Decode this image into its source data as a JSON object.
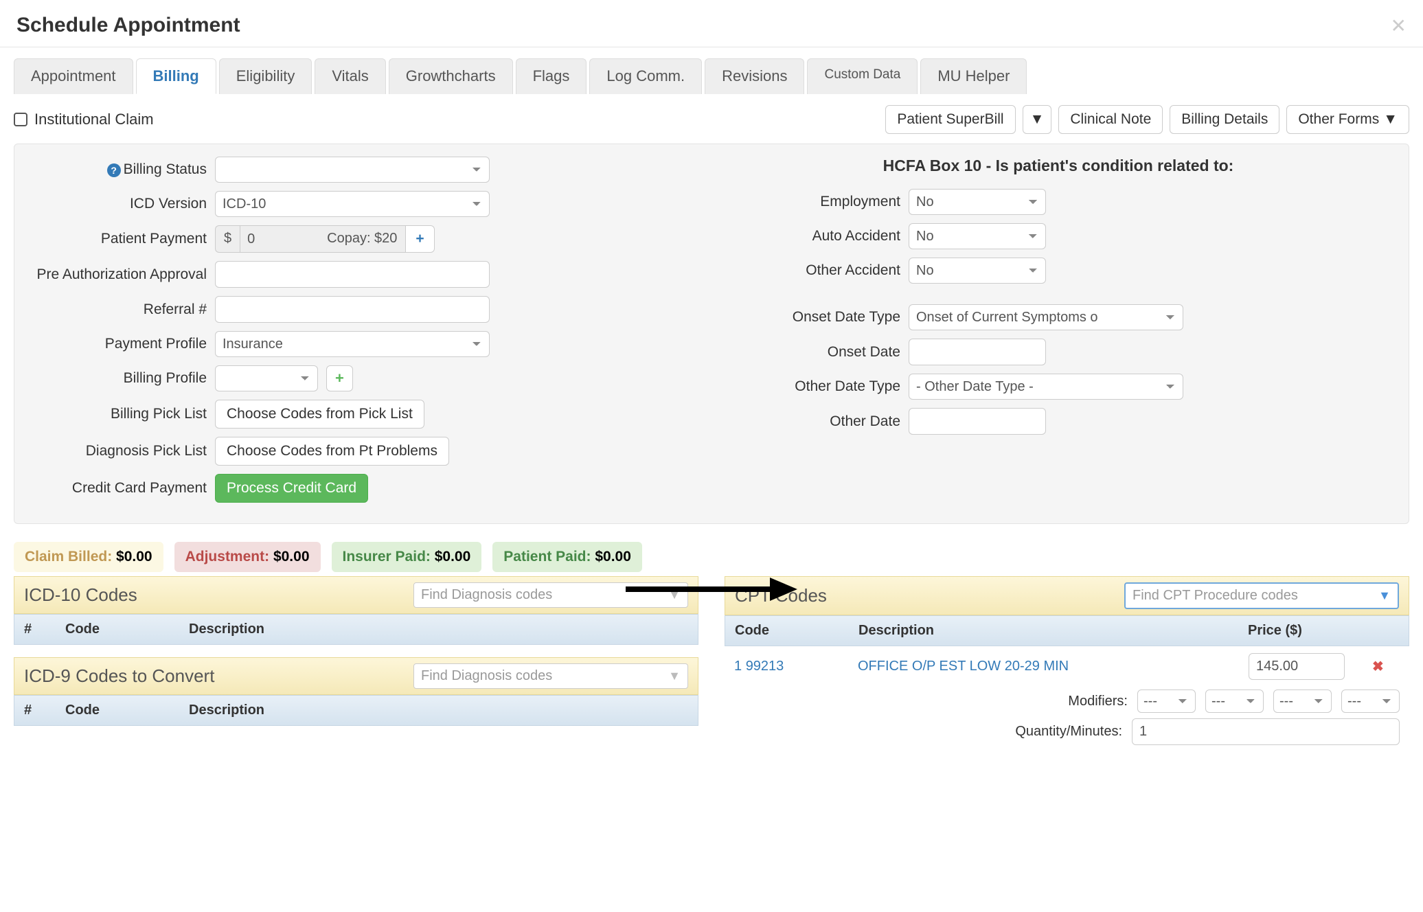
{
  "header": {
    "title": "Schedule Appointment"
  },
  "tabs": [
    "Appointment",
    "Billing",
    "Eligibility",
    "Vitals",
    "Growthcharts",
    "Flags",
    "Log Comm.",
    "Revisions",
    "Custom Data",
    "MU Helper"
  ],
  "active_tab": "Billing",
  "institutional_claim_label": "Institutional Claim",
  "top_buttons": {
    "superbill": "Patient SuperBill",
    "clinical_note": "Clinical Note",
    "billing_details": "Billing Details",
    "other_forms": "Other Forms"
  },
  "left_form": {
    "billing_status_label": "Billing Status",
    "icd_version_label": "ICD Version",
    "icd_version_value": "ICD-10",
    "patient_payment_label": "Patient Payment",
    "patient_payment_currency": "$",
    "patient_payment_value": "0",
    "patient_payment_copay": "Copay: $20",
    "pre_auth_label": "Pre Authorization Approval",
    "referral_label": "Referral #",
    "payment_profile_label": "Payment Profile",
    "payment_profile_value": "Insurance",
    "billing_profile_label": "Billing Profile",
    "billing_picklist_label": "Billing Pick List",
    "billing_picklist_btn": "Choose Codes from Pick List",
    "diagnosis_picklist_label": "Diagnosis Pick List",
    "diagnosis_picklist_btn": "Choose Codes from Pt Problems",
    "cc_payment_label": "Credit Card Payment",
    "cc_payment_btn": "Process Credit Card"
  },
  "right_form": {
    "hcfa_title": "HCFA Box 10 - Is patient's condition related to:",
    "employment_label": "Employment",
    "employment_value": "No",
    "auto_accident_label": "Auto Accident",
    "auto_accident_value": "No",
    "other_accident_label": "Other Accident",
    "other_accident_value": "No",
    "onset_date_type_label": "Onset Date Type",
    "onset_date_type_value": "Onset of Current Symptoms o",
    "onset_date_label": "Onset Date",
    "other_date_type_label": "Other Date Type",
    "other_date_type_value": "- Other Date Type -",
    "other_date_label": "Other Date"
  },
  "summary": {
    "claim_billed_label": "Claim Billed:",
    "claim_billed_value": "$0.00",
    "adjustment_label": "Adjustment:",
    "adjustment_value": "$0.00",
    "insurer_paid_label": "Insurer Paid:",
    "insurer_paid_value": "$0.00",
    "patient_paid_label": "Patient Paid:",
    "patient_paid_value": "$0.00"
  },
  "icd10": {
    "title": "ICD-10 Codes",
    "search_placeholder": "Find Diagnosis codes",
    "cols": {
      "num": "#",
      "code": "Code",
      "desc": "Description"
    }
  },
  "icd9": {
    "title": "ICD-9 Codes to Convert",
    "search_placeholder": "Find Diagnosis codes",
    "cols": {
      "num": "#",
      "code": "Code",
      "desc": "Description"
    }
  },
  "cpt": {
    "title": "CPT Codes",
    "search_placeholder": "Find CPT Procedure codes",
    "cols": {
      "code": "Code",
      "desc": "Description",
      "price": "Price ($)"
    },
    "row": {
      "num": "1",
      "code": "99213",
      "desc": "OFFICE O/P EST LOW 20-29 MIN",
      "price": "145.00"
    },
    "modifiers_label": "Modifiers:",
    "modifier_value": "---",
    "qty_label": "Quantity/Minutes:",
    "qty_value": "1"
  }
}
